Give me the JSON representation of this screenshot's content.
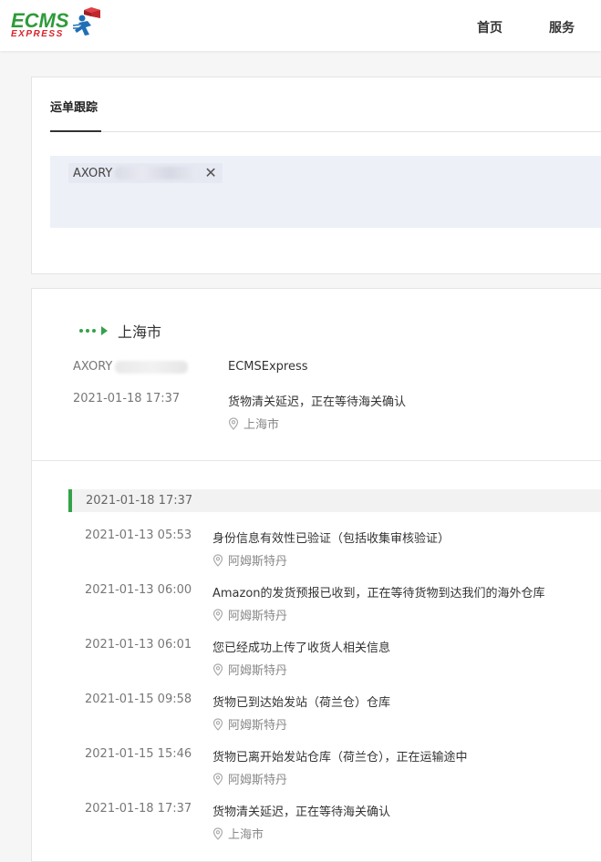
{
  "header": {
    "logo_text": "ECMS",
    "logo_sub": "EXPRESS",
    "nav": [
      "首页",
      "服务"
    ]
  },
  "tracking": {
    "tab_title": "运单跟踪",
    "chip_prefix": "AXORY",
    "chip_close": "✕"
  },
  "result": {
    "route_city": "上海市",
    "waybill_prefix": "AXORY",
    "carrier": "ECMSExpress",
    "latest_time": "2021-01-18 17:37",
    "latest_desc": "货物清关延迟，正在等待海关确认",
    "latest_location": "上海市",
    "date_bar": "2021-01-18 17:37",
    "events": [
      {
        "time": "2021-01-13 05:53",
        "desc": "身份信息有效性已验证（包括收集审核验证）",
        "location": "阿姆斯特丹"
      },
      {
        "time": "2021-01-13 06:00",
        "desc": "Amazon的发货预报已收到，正在等待货物到达我们的海外仓库",
        "location": "阿姆斯特丹"
      },
      {
        "time": "2021-01-13 06:01",
        "desc": "您已经成功上传了收货人相关信息",
        "location": "阿姆斯特丹"
      },
      {
        "time": "2021-01-15 09:58",
        "desc": "货物已到达始发站（荷兰仓）仓库",
        "location": "阿姆斯特丹"
      },
      {
        "time": "2021-01-15 15:46",
        "desc": "货物已离开始发站仓库（荷兰仓），正在运输途中",
        "location": "阿姆斯特丹"
      },
      {
        "time": "2021-01-18 17:37",
        "desc": "货物清关延迟，正在等待海关确认",
        "location": "上海市"
      }
    ]
  },
  "colors": {
    "accent_green": "#34a24a",
    "logo_red": "#d8232a"
  }
}
